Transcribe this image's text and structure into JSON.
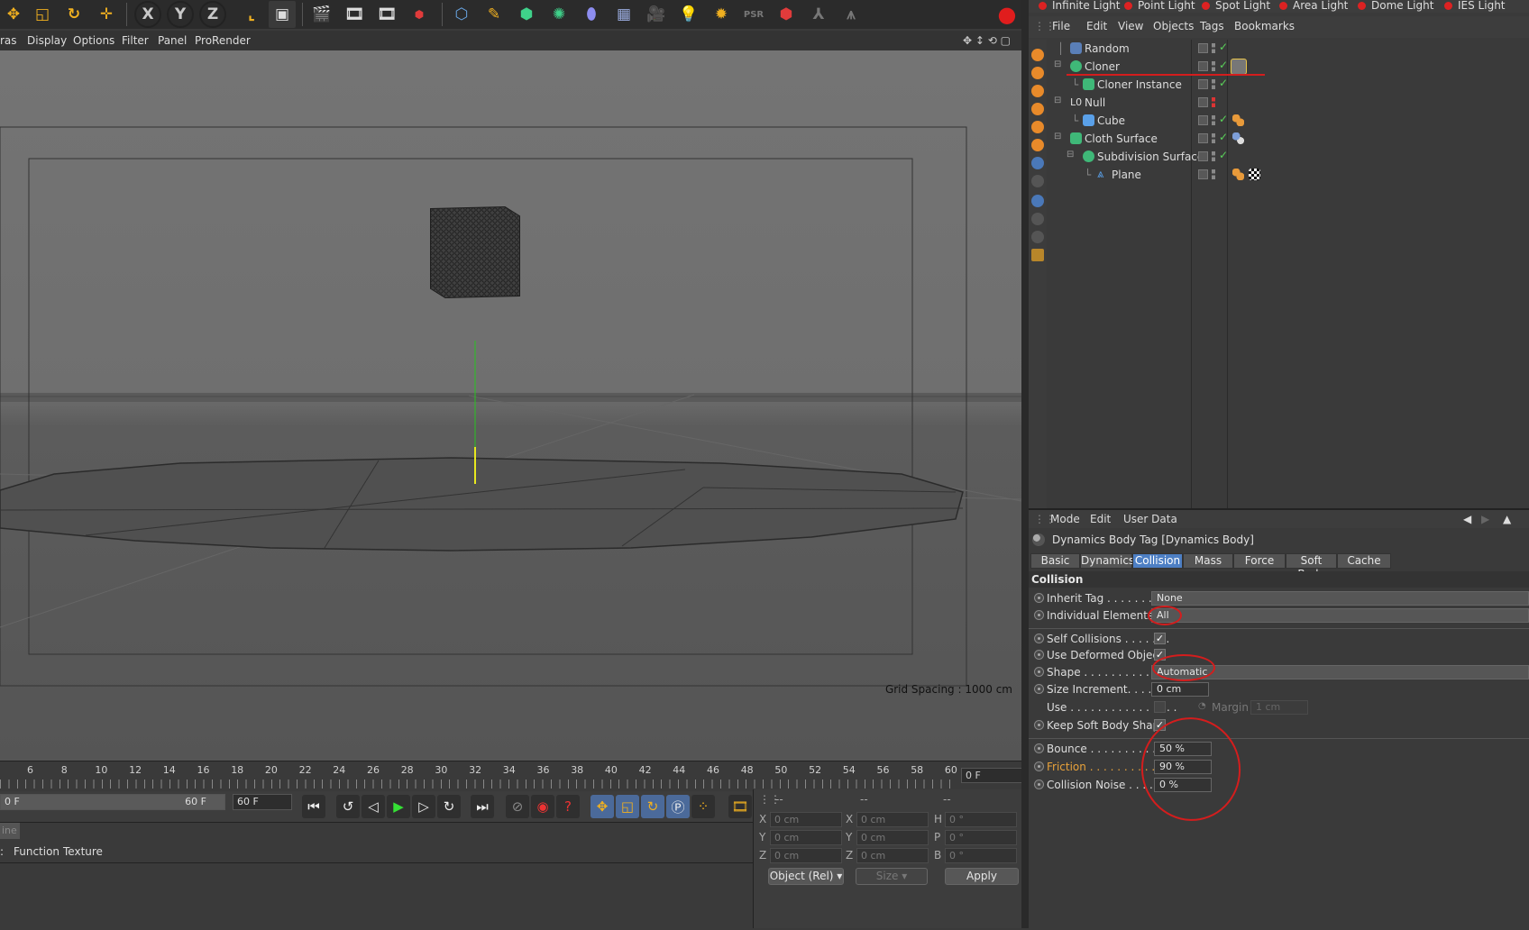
{
  "toolbar": {
    "xyz": [
      "X",
      "Y",
      "Z"
    ]
  },
  "lights": [
    "Infinite Light",
    "Point Light",
    "Spot Light",
    "Area Light",
    "Dome Light",
    "IES Light"
  ],
  "viewport": {
    "menu": [
      "ras",
      "Display",
      "Options",
      "Filter",
      "Panel",
      "ProRender"
    ],
    "grid_spacing": "Grid Spacing : 1000 cm"
  },
  "timeline": {
    "ticks": [
      "6",
      "8",
      "10",
      "12",
      "14",
      "16",
      "18",
      "20",
      "22",
      "24",
      "26",
      "28",
      "30",
      "32",
      "34",
      "36",
      "38",
      "40",
      "42",
      "44",
      "46",
      "48",
      "50",
      "52",
      "54",
      "56",
      "58",
      "60"
    ],
    "current_frame": "0 F",
    "range_start": "0 F",
    "range_end": "60 F",
    "end_frame": "60 F"
  },
  "bottom_panel": {
    "menu": [
      "ine"
    ],
    "tabs": [
      "Function",
      "Texture"
    ]
  },
  "coordinates": {
    "header": [
      "--",
      "--",
      "--"
    ],
    "rows": [
      {
        "l1": "X",
        "v1": "0 cm",
        "l2": "X",
        "v2": "0 cm",
        "l3": "H",
        "v3": "0 °"
      },
      {
        "l1": "Y",
        "v1": "0 cm",
        "l2": "Y",
        "v2": "0 cm",
        "l3": "P",
        "v3": "0 °"
      },
      {
        "l1": "Z",
        "v1": "0 cm",
        "l2": "Z",
        "v2": "0 cm",
        "l3": "B",
        "v3": "0 °"
      }
    ],
    "mode": "Object (Rel)",
    "size": "Size",
    "apply": "Apply"
  },
  "object_manager": {
    "menu": [
      "File",
      "Edit",
      "View",
      "Objects",
      "Tags",
      "Bookmarks"
    ],
    "objects": [
      {
        "name": "Random"
      },
      {
        "name": "Cloner"
      },
      {
        "name": "Cloner Instance"
      },
      {
        "name": "Null"
      },
      {
        "name": "Cube"
      },
      {
        "name": "Cloth Surface"
      },
      {
        "name": "Subdivision Surface"
      },
      {
        "name": "Plane"
      }
    ]
  },
  "attribute_manager": {
    "menu": [
      "Mode",
      "Edit",
      "User Data"
    ],
    "title": "Dynamics Body Tag [Dynamics Body]",
    "tabs": [
      "Basic",
      "Dynamics",
      "Collision",
      "Mass",
      "Force",
      "Soft Body",
      "Cache"
    ],
    "active_tab": "Collision",
    "section": "Collision",
    "fields": {
      "inherit_tag": {
        "label": "Inherit Tag . . . . . . . . . .",
        "value": "None"
      },
      "individual_elements": {
        "label": "Individual Elements. .",
        "value": "All"
      },
      "self_collisions": {
        "label": "Self Collisions . . . . . . ."
      },
      "use_deformed_object": {
        "label": "Use Deformed Object"
      },
      "shape": {
        "label": "Shape . . . . . . . . . . . . . .",
        "value": "Automatic"
      },
      "size_increment": {
        "label": "Size Increment. . . . . . .",
        "value": "0 cm"
      },
      "use": {
        "label": "Use . . . . . . . . . . . . . . . .",
        "margin_label": "Margin",
        "margin_value": "1 cm"
      },
      "keep_soft_body_shape": {
        "label": "Keep Soft Body Shape"
      },
      "bounce": {
        "label": "Bounce . . . . . . . . . . . . .",
        "value": "50 %"
      },
      "friction": {
        "label": "Friction . . . . . . . . . . . . .",
        "value": "90 %"
      },
      "collision_noise": {
        "label": "Collision Noise . . . . . . .",
        "value": "0 %"
      }
    }
  },
  "colors": {
    "accent": "#4d7fc4",
    "annotation": "#d41d1d",
    "friction_label": "#e8a23a"
  }
}
